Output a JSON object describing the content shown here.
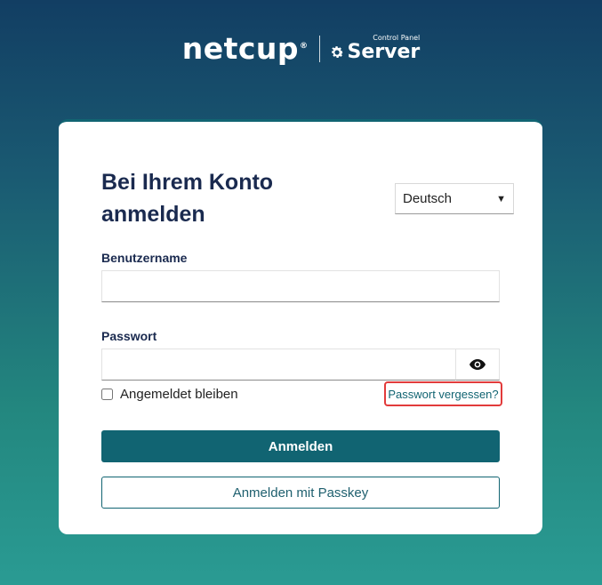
{
  "brand": {
    "logo_text": "netcup",
    "registered_mark": "®",
    "product_small": "Control Panel",
    "product_big": "Server",
    "icon": "gear-icon"
  },
  "login": {
    "title": "Bei Ihrem Konto anmelden",
    "language": {
      "selected": "Deutsch",
      "icon": "caret-down-icon"
    },
    "username": {
      "label": "Benutzername",
      "value": "",
      "placeholder": ""
    },
    "password": {
      "label": "Passwort",
      "value": "",
      "placeholder": "",
      "toggle_icon": "eye-icon"
    },
    "remember_me": {
      "label": "Angemeldet bleiben",
      "checked": false
    },
    "forgot_password": "Passwort vergessen?",
    "submit_label": "Anmelden",
    "passkey_label": "Anmelden mit Passkey"
  },
  "colors": {
    "primary": "#116472",
    "title": "#1a2a4f",
    "highlight": "#e23b3b",
    "background_top": "#123e63",
    "background_bottom": "#2a9b93"
  }
}
